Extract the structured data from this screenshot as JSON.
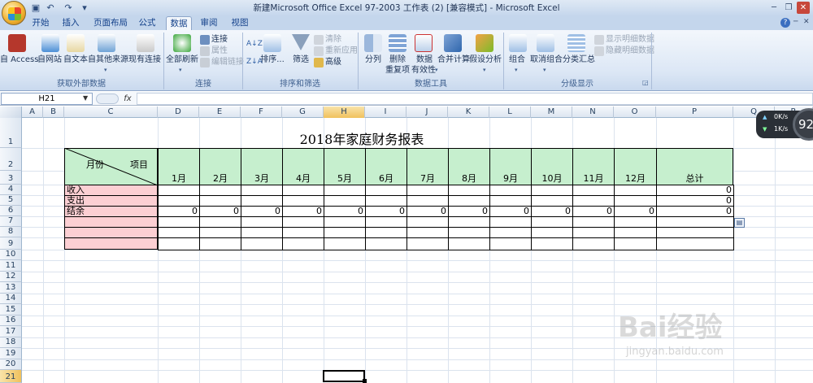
{
  "window": {
    "title": "新建Microsoft Office Excel 97-2003 工作表 (2)  [兼容模式] - Microsoft Excel"
  },
  "tabs": [
    {
      "label": "开始"
    },
    {
      "label": "插入"
    },
    {
      "label": "页面布局"
    },
    {
      "label": "公式"
    },
    {
      "label": "数据",
      "active": true
    },
    {
      "label": "审阅"
    },
    {
      "label": "视图"
    }
  ],
  "ribbon": {
    "get_external": {
      "group_label": "获取外部数据",
      "access": "自 Access",
      "web": "自网站",
      "text": "自文本",
      "other": "自其他来源",
      "existing": "现有连接"
    },
    "connections": {
      "group_label": "连接",
      "refresh_all": "全部刷新",
      "connections": "连接",
      "properties": "属性",
      "edit_links": "编辑链接"
    },
    "sort_filter": {
      "group_label": "排序和筛选",
      "sort": "排序...",
      "filter": "筛选",
      "clear": "清除",
      "reapply": "重新应用",
      "advanced": "高级"
    },
    "data_tools": {
      "group_label": "数据工具",
      "text_to_columns": "分列",
      "remove_dup_1": "删除",
      "remove_dup_2": "重复项",
      "validation_1": "数据",
      "validation_2": "有效性",
      "consolidate": "合并计算",
      "whatif": "假设分析"
    },
    "outline": {
      "group_label": "分级显示",
      "group": "组合",
      "ungroup": "取消组合",
      "subtotal": "分类汇总",
      "show_detail": "显示明细数据",
      "hide_detail": "隐藏明细数据"
    }
  },
  "formula_bar": {
    "name_box": "H21",
    "fx": "fx",
    "value": ""
  },
  "grid": {
    "columns": [
      "A",
      "B",
      "C",
      "D",
      "E",
      "F",
      "G",
      "H",
      "I",
      "J",
      "K",
      "L",
      "M",
      "N",
      "O",
      "P",
      "Q",
      "R"
    ],
    "selected_column": "H",
    "rows": [
      "1",
      "2",
      "3",
      "4",
      "5",
      "6",
      "7",
      "8",
      "9",
      "10",
      "11",
      "12",
      "13",
      "14",
      "15",
      "16",
      "17",
      "18",
      "19",
      "20",
      "21"
    ],
    "selected_row": "21"
  },
  "sheet": {
    "title": "2018年家庭财务报表",
    "header_diag_top": "项目",
    "header_diag_bottom": "月份",
    "months": [
      "1月",
      "2月",
      "3月",
      "4月",
      "5月",
      "6月",
      "7月",
      "8月",
      "9月",
      "10月",
      "11月",
      "12月"
    ],
    "total_label": "总计",
    "row_labels": [
      "收入",
      "支出",
      "结余"
    ],
    "income_total": "0",
    "expense_total": "0",
    "balance_values": [
      "0",
      "0",
      "0",
      "0",
      "0",
      "0",
      "0",
      "0",
      "0",
      "0",
      "0",
      "0",
      "0"
    ]
  },
  "overlay": {
    "upload": "0K/s",
    "download": "1K/s",
    "percent": "92"
  },
  "watermark": {
    "brand": "Bai经验",
    "url": "jingyan.baidu.com"
  },
  "colors": {
    "header_green": "#c6efce",
    "label_pink": "#fccfd3",
    "selection": "#f0c15d",
    "ribbon": "#dce7f5"
  }
}
